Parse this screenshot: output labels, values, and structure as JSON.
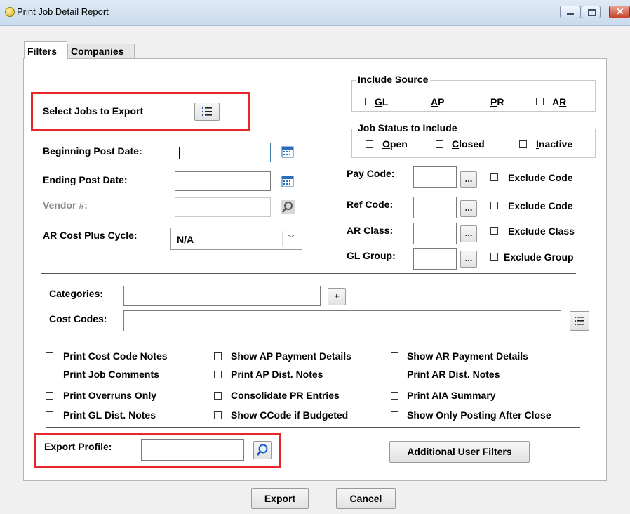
{
  "window": {
    "title": "Print Job Detail Report",
    "icon": "printer-app-icon"
  },
  "tabs": [
    {
      "label": "Filters"
    },
    {
      "label": "Companies"
    }
  ],
  "select_jobs": {
    "label": "Select Jobs to Export"
  },
  "fields": {
    "beginning_post_date": {
      "label": "Beginning Post Date:",
      "value": ""
    },
    "ending_post_date": {
      "label": "Ending Post Date:",
      "value": ""
    },
    "vendor": {
      "label": "Vendor #:",
      "value": ""
    },
    "ar_cost_plus_cycle": {
      "label": "AR Cost Plus Cycle:",
      "selected": "N/A"
    },
    "categories": {
      "label": "Categories:",
      "value": ""
    },
    "cost_codes": {
      "label": "Cost Codes:",
      "value": ""
    },
    "export_profile": {
      "label": "Export Profile:",
      "value": ""
    }
  },
  "include_source": {
    "title": "Include Source",
    "options": [
      {
        "prefix": "",
        "key": "G",
        "rest": "L"
      },
      {
        "prefix": "",
        "key": "A",
        "rest": "P"
      },
      {
        "prefix": "",
        "key": "P",
        "rest": "R"
      },
      {
        "prefix": "A",
        "key": "R",
        "rest": ""
      }
    ]
  },
  "job_status": {
    "title": "Job Status to Include",
    "options": [
      {
        "key": "O",
        "rest": "pen"
      },
      {
        "key": "C",
        "rest": "losed"
      },
      {
        "key": "I",
        "rest": "nactive"
      }
    ]
  },
  "codes": [
    {
      "label": "Pay Code:",
      "value": "",
      "exclude": "Exclude Code"
    },
    {
      "label": "Ref Code:",
      "value": "",
      "exclude": "Exclude Code"
    },
    {
      "label": "AR Class:",
      "value": "",
      "exclude": "Exclude Class"
    },
    {
      "label": "GL Group:",
      "value": "",
      "exclude": "Exclude Group"
    }
  ],
  "ellipsis": "...",
  "plus": "+",
  "options": {
    "col1": [
      "Print Cost Code Notes",
      "Print Job Comments",
      "Print Overruns Only",
      "Print GL Dist. Notes"
    ],
    "col2": [
      "Show AP Payment Details",
      "Print AP Dist. Notes",
      "Consolidate PR Entries",
      "Show CCode if Budgeted"
    ],
    "col3": [
      "Show AR Payment Details",
      "Print AR Dist. Notes",
      "Print AIA Summary",
      "Show Only Posting After Close"
    ]
  },
  "buttons": {
    "additional_user_filters": "Additional User Filters",
    "export": "Export",
    "cancel": "Cancel"
  },
  "colors": {
    "highlight_box": "#e8262b",
    "title_bar": "#c9dbee"
  }
}
